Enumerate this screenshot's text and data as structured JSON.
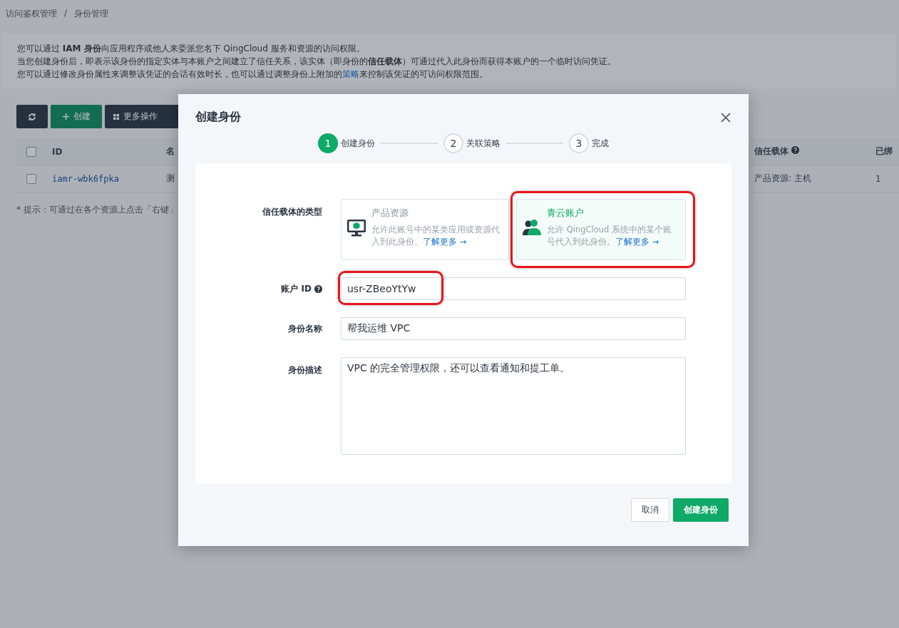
{
  "breadcrumb": {
    "items": [
      "访问鉴权管理",
      "身份管理"
    ],
    "separator": "/"
  },
  "info": {
    "lines": [
      "您可以通过 **IAM 身份**向应用程序或他人来委派您名下 QingCloud 服务和资源的访问权限。",
      "当您创建身份后，即表示该身份的指定实体与本账户之间建立了信任关系，该实体（即身份的**信任载体**）可通过代入此身份而获得本账户的一个临时访问凭证。"
    ],
    "last_line": {
      "before": "您可以通过修改身份属性来调整该凭证的会话有效时长，也可以通过调整身份上附加的",
      "link": "策略",
      "after": "来控制该凭证的可访问权限范围。"
    }
  },
  "toolbar": [
    {
      "kind": "refresh"
    },
    {
      "kind": "create",
      "label": "创建"
    },
    {
      "kind": "more",
      "label": "更多操作"
    }
  ],
  "table": {
    "header_checked": false,
    "columns": [
      "ID",
      "名",
      "信任载体",
      "已绑"
    ],
    "rows": [
      {
        "checked": false,
        "cells": [
          "iamr-wbk6fpka",
          "测",
          "产品资源: 主机",
          "1"
        ]
      }
    ]
  },
  "hint": "* 提示：可通过在各个资源上点击「右键」",
  "dialog": {
    "title": "创建身份",
    "steps": [
      {
        "number": "1",
        "label": "创建身份",
        "selected": true
      },
      {
        "number": "2",
        "label": "关联策略",
        "selected": false
      },
      {
        "number": "3",
        "label": "完成",
        "selected": false
      }
    ],
    "type_label": "信任载体的类型",
    "options": [
      {
        "kind": "monitor",
        "title": "产品资源",
        "description": "允许此账号中的某类应用或资源代入到此身份。",
        "link": "了解更多 →",
        "selected": false,
        "highlighted": false
      },
      {
        "kind": "users",
        "title": "青云账户",
        "description": "允许 QingCloud 系统中的某个账号代入到此身份。",
        "link": "了解更多 →",
        "selected": true,
        "highlighted": true
      }
    ],
    "fields": [
      {
        "kind": "input",
        "label": "账户 ID",
        "help": true,
        "value": "usr-ZBeoYtYw",
        "highlighted": true
      },
      {
        "kind": "input",
        "label": "身份名称",
        "help": false,
        "value": "帮我运维 VPC",
        "highlighted": false
      },
      {
        "kind": "textarea",
        "label": "身份描述",
        "help": false,
        "value": "VPC 的完全管理权限，还可以查看通知和提工单。",
        "highlighted": false
      }
    ],
    "buttons": [
      {
        "kind": "secondary",
        "label": "取消"
      },
      {
        "kind": "primary",
        "label": "创建身份"
      }
    ]
  }
}
